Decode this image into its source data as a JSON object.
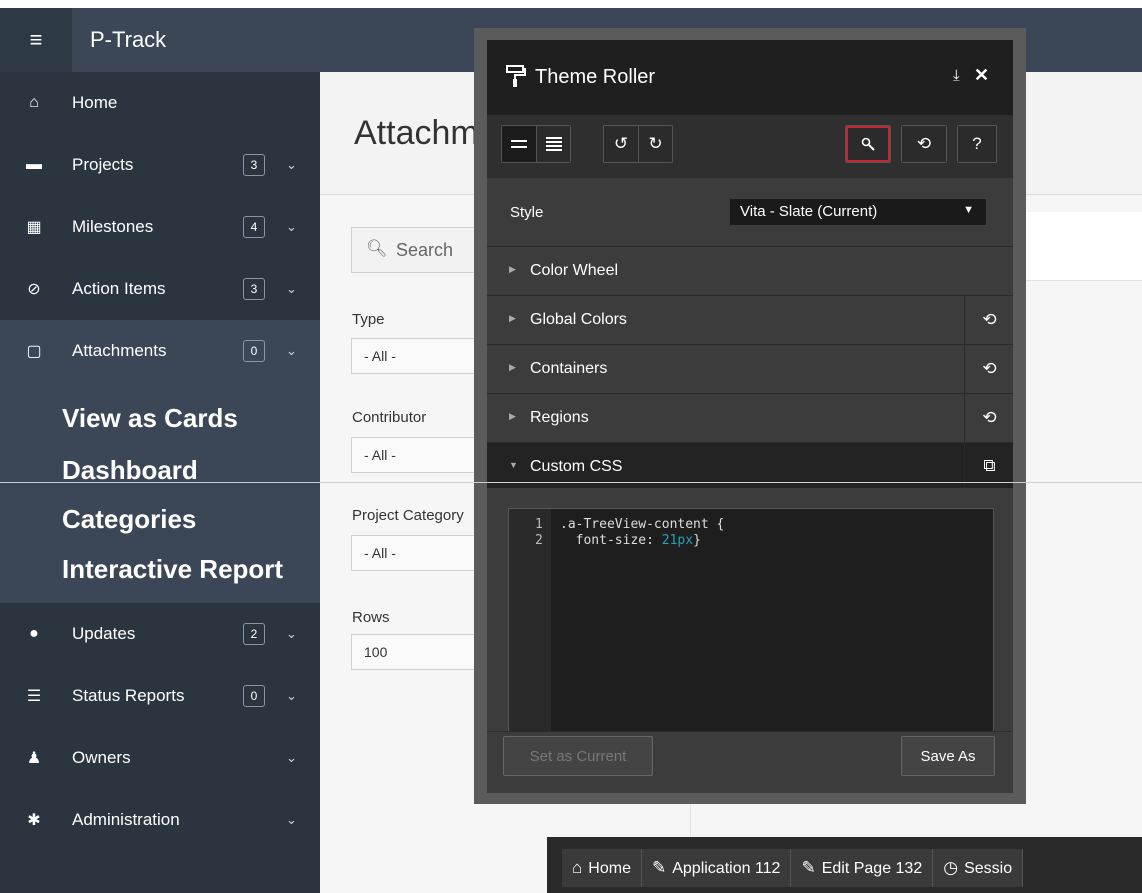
{
  "app": {
    "menu_icon": "≡",
    "brand": "P-Track"
  },
  "sidebar": {
    "items": [
      {
        "label": "Home",
        "icon": "home-icon",
        "glyph": "⌂",
        "badge": "",
        "chevron": ""
      },
      {
        "label": "Projects",
        "icon": "archive-icon",
        "glyph": "▬",
        "badge": "3",
        "chevron": "⌄"
      },
      {
        "label": "Milestones",
        "icon": "calendar-icon",
        "glyph": "▦",
        "badge": "4",
        "chevron": "⌄"
      },
      {
        "label": "Action Items",
        "icon": "check-circle-icon",
        "glyph": "⊘",
        "badge": "3",
        "chevron": "⌄"
      },
      {
        "label": "Attachments",
        "icon": "file-icon",
        "glyph": "▢",
        "badge": "0",
        "chevron": "⌄"
      },
      {
        "label": "Updates",
        "icon": "comment-icon",
        "glyph": "●",
        "badge": "2",
        "chevron": "⌄"
      },
      {
        "label": "Status Reports",
        "icon": "list-icon",
        "glyph": "☰",
        "badge": "0",
        "chevron": "⌄"
      },
      {
        "label": "Owners",
        "icon": "user-icon",
        "glyph": "♟",
        "badge": "",
        "chevron": "⌄"
      },
      {
        "label": "Administration",
        "icon": "gear-icon",
        "glyph": "✱",
        "badge": "",
        "chevron": "⌄"
      }
    ],
    "submenu": [
      "View as Cards",
      "Dashboard",
      "Categories",
      "Interactive Report"
    ]
  },
  "page": {
    "title": "Attachm",
    "search_placeholder": "Search",
    "filters": [
      {
        "label": "Type",
        "value": "- All -"
      },
      {
        "label": "Contributor",
        "value": "- All -"
      },
      {
        "label": "Project Category",
        "value": "- All -"
      },
      {
        "label": "Rows",
        "value": "100"
      }
    ]
  },
  "theme_roller": {
    "title": "Theme Roller",
    "dock_icon": "⤓",
    "close_icon": "✕",
    "style_label": "Style",
    "style_value": "Vita - Slate (Current)",
    "sections": [
      {
        "name": "Color Wheel",
        "action": ""
      },
      {
        "name": "Global Colors",
        "action": "⟲"
      },
      {
        "name": "Containers",
        "action": "⟲"
      },
      {
        "name": "Regions",
        "action": "⟲"
      },
      {
        "name": "Custom CSS",
        "action": "⧉"
      }
    ],
    "css_lines": [
      {
        "n": "1",
        "text": ".a-TreeView-content {"
      },
      {
        "n": "2",
        "pre": "  font-size: ",
        "num": "21px",
        "post": "}"
      }
    ],
    "set_current_label": "Set as Current",
    "save_as_label": "Save As"
  },
  "dev_toolbar": [
    {
      "label": "Home",
      "icon": "home-outline-icon",
      "glyph": "⌂"
    },
    {
      "label": "Application 112",
      "icon": "edit-icon",
      "glyph": "✎"
    },
    {
      "label": "Edit Page 132",
      "icon": "edit-page-icon",
      "glyph": "✎"
    },
    {
      "label": "Sessio",
      "icon": "clock-icon",
      "glyph": "◷"
    }
  ]
}
